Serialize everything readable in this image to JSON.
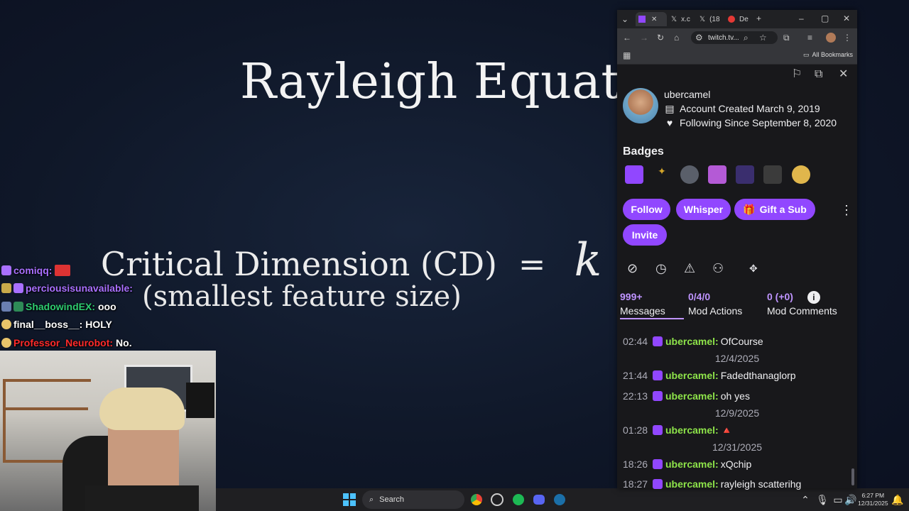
{
  "slide": {
    "title": "Rayleigh Equatio",
    "equation_left": "Critical Dimension (CD)",
    "equation_sign": "=",
    "equation_right": "k",
    "subtitle": "(smallest feature size)"
  },
  "overlay_chat": [
    {
      "user": "comiqq:",
      "color": "#a970ff",
      "message": ""
    },
    {
      "user": "perciousisunavailable:",
      "color": "#a970ff",
      "message": ""
    },
    {
      "user": "ShadowindEX:",
      "color": "#2ecc71",
      "message": "ooo"
    },
    {
      "user": "final__boss__:",
      "color": "#ffffff",
      "message": "HOLY"
    },
    {
      "user": "Professor_Neurobot:",
      "color": "#ff2a2a",
      "message": "No."
    }
  ],
  "browser": {
    "tabs": [
      "x.c",
      "(18",
      "De"
    ],
    "address": "twitch.tv...",
    "bookmarks_label": "All Bookmarks"
  },
  "viewer_card": {
    "username": "ubercamel",
    "account_created": "Account Created March 9, 2019",
    "following_since": "Following Since September 8, 2020",
    "badges_heading": "Badges",
    "badges": [
      "sub-cake",
      "golden-bird",
      "robot",
      "2023",
      "2024",
      "2025",
      "gold-star"
    ],
    "buttons": {
      "follow": "Follow",
      "whisper": "Whisper",
      "gift": "Gift a Sub",
      "invite": "Invite"
    },
    "stats": [
      {
        "value": "999+",
        "label": "Messages"
      },
      {
        "value": "0/4/0",
        "label": "Mod Actions"
      },
      {
        "value": "0 (+0)",
        "label": "Mod Comments"
      }
    ],
    "log": [
      {
        "type": "msg",
        "time": "02:44",
        "user": "ubercamel:",
        "message": "OfCourse"
      },
      {
        "type": "date",
        "date": "12/4/2025"
      },
      {
        "type": "msg",
        "time": "21:44",
        "user": "ubercamel:",
        "message": "Fadedthanaglorp"
      },
      {
        "type": "msg",
        "time": "22:13",
        "user": "ubercamel:",
        "message": "oh yes"
      },
      {
        "type": "date",
        "date": "12/9/2025"
      },
      {
        "type": "msg",
        "time": "01:28",
        "user": "ubercamel:",
        "message": "🔺"
      },
      {
        "type": "date",
        "date": "12/31/2025"
      },
      {
        "type": "msg",
        "time": "18:26",
        "user": "ubercamel:",
        "message": "xQchip"
      },
      {
        "type": "msg",
        "time": "18:27",
        "user": "ubercamel:",
        "message": "rayleigh scatterihg"
      }
    ]
  },
  "taskbar": {
    "search_label": "Search",
    "time": "6:27 PM",
    "date": "12/31/2025"
  }
}
